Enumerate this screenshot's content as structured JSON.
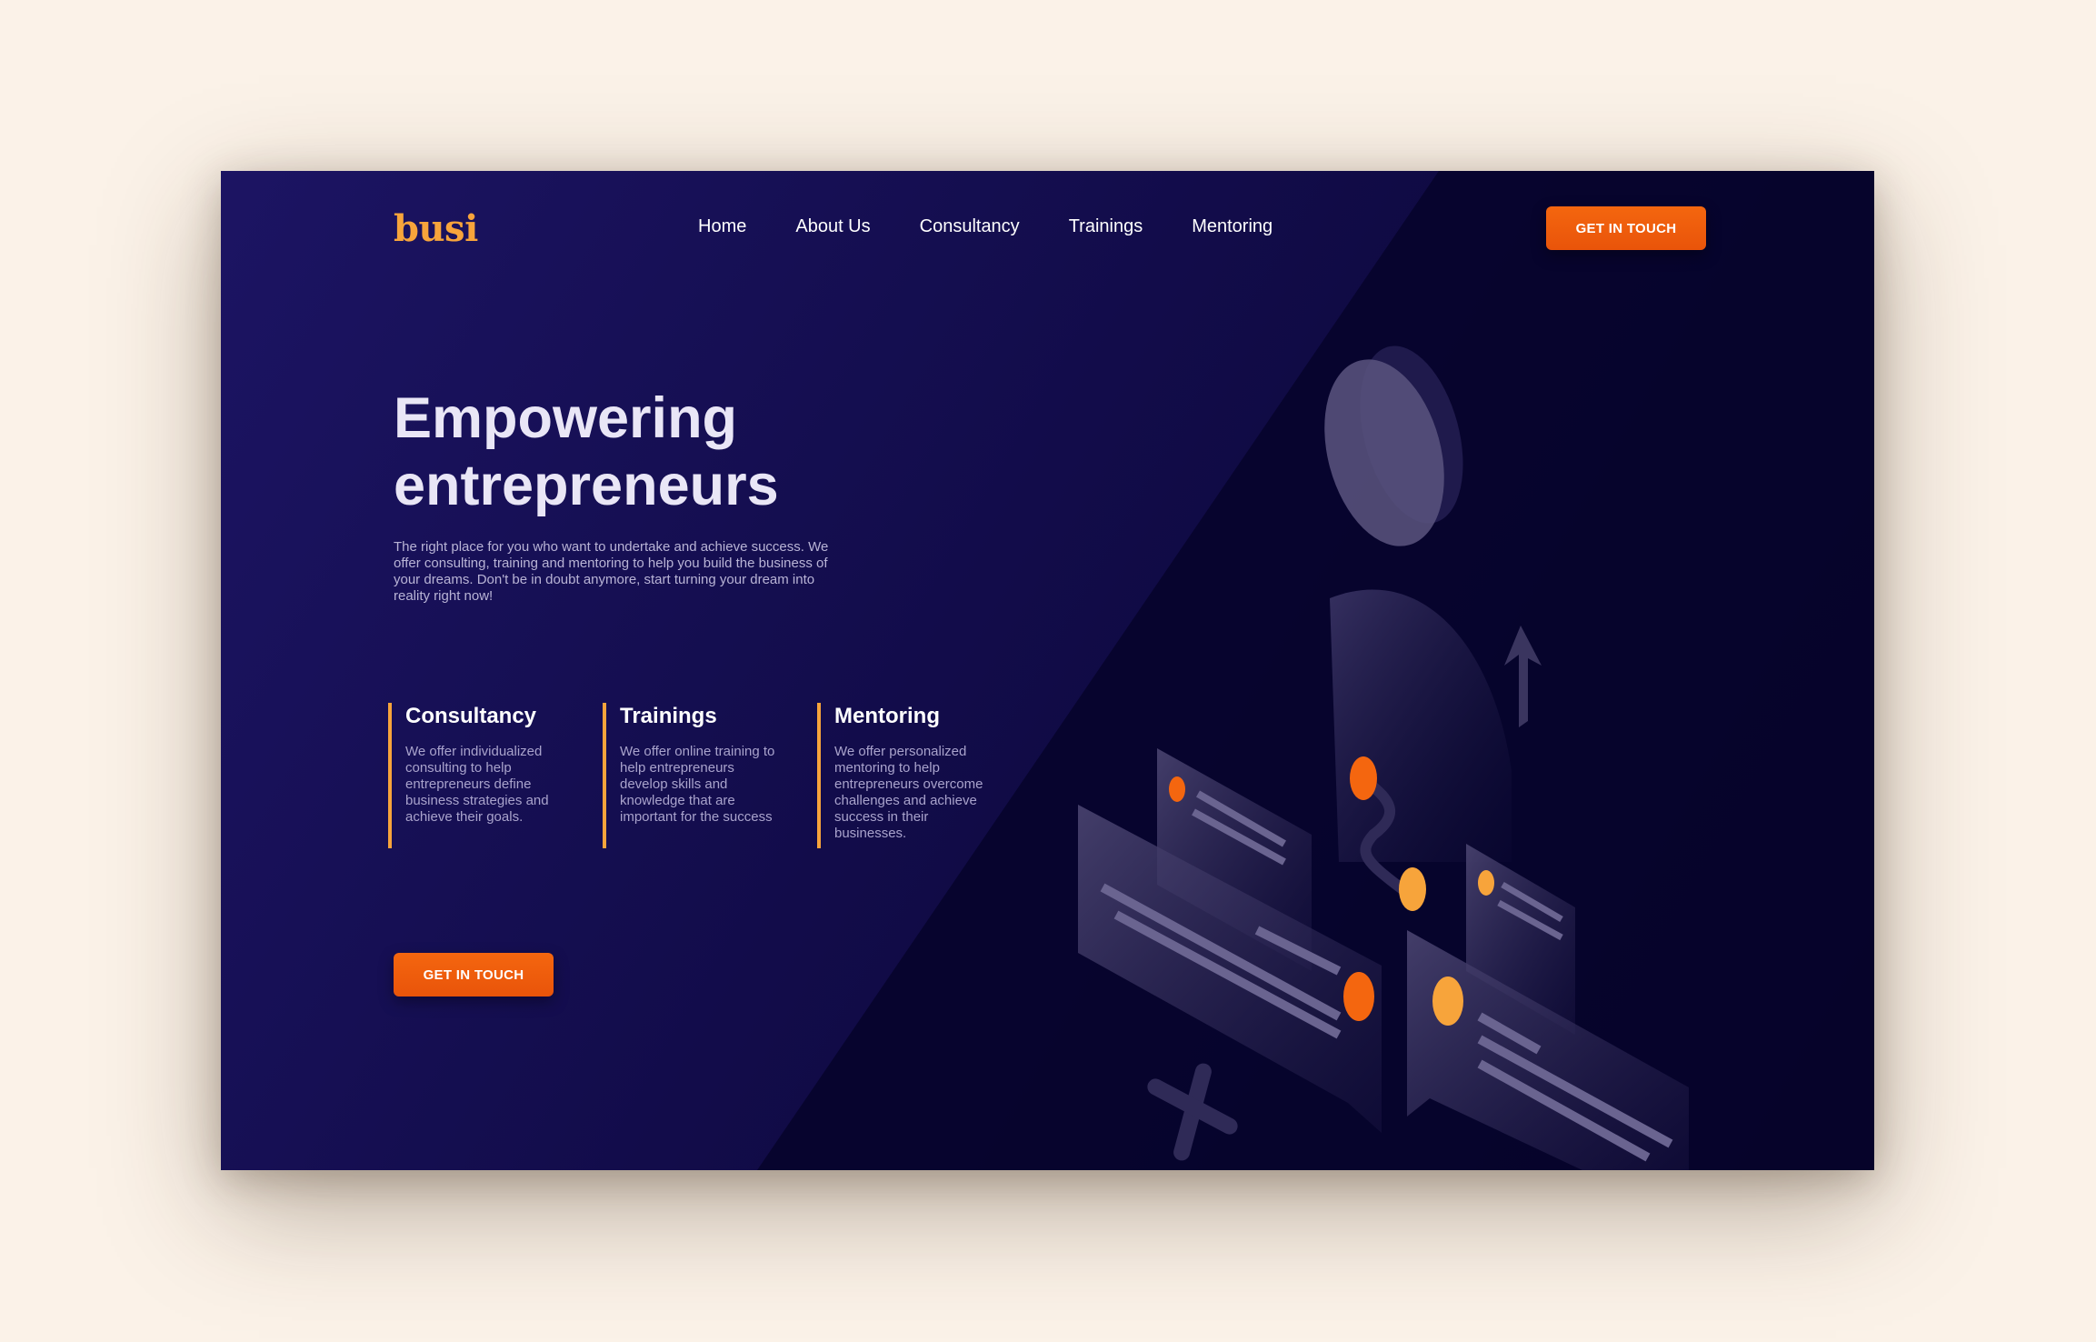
{
  "brand": {
    "logo": "busi"
  },
  "nav": {
    "items": [
      "Home",
      "About Us",
      "Consultancy",
      "Trainings",
      "Mentoring"
    ],
    "cta_label": "GET IN TOUCH"
  },
  "hero": {
    "title_line1": "Empowering",
    "title_line2": "entrepreneurs",
    "description": "The right place for you who want to undertake and achieve success. We offer consulting, training and mentoring to help you build the business of your dreams. Don't be in doubt anymore, start turning your dream into reality right now!",
    "cta_label": "GET IN TOUCH"
  },
  "features": [
    {
      "title": "Consultancy",
      "text": "We offer individualized consulting to help entrepreneurs define business strategies and achieve their goals."
    },
    {
      "title": "Trainings",
      "text": "We offer online training to help entrepreneurs develop skills and knowledge that are important for the success"
    },
    {
      "title": "Mentoring",
      "text": "We offer personalized mentoring to help entrepreneurs overcome challenges and achieve success in their businesses."
    }
  ],
  "colors": {
    "background": "#fbf2e8",
    "hero_bg": "#120c4a",
    "accent_orange": "#f4660f",
    "accent_yellow": "#f7a43b",
    "text_light": "#e9e6f6"
  }
}
